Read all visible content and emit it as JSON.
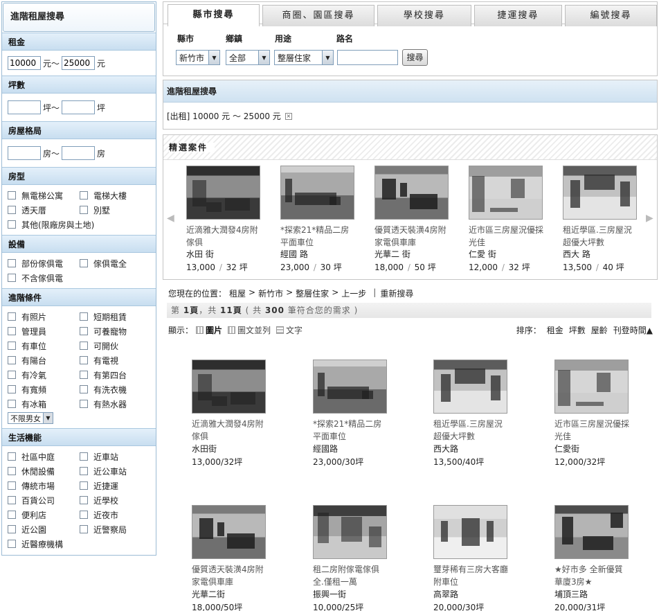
{
  "sidebar": {
    "title": "進階租屋搜尋",
    "rent": {
      "label": "租金",
      "min": "10000",
      "sep": "元～",
      "max": "25000",
      "unit": "元"
    },
    "area": {
      "label": "坪數",
      "sep": "坪～",
      "unit": "坪"
    },
    "layout": {
      "label": "房屋格局",
      "sep": "房～",
      "unit": "房"
    },
    "type": {
      "label": "房型",
      "items": [
        "無電梯公寓",
        "電梯大樓",
        "透天厝",
        "別墅",
        "其他(限廠房與土地)"
      ]
    },
    "furniture": {
      "label": "設備",
      "items": [
        "部份傢俱電",
        "傢俱電全",
        "不含傢俱電"
      ]
    },
    "advanced": {
      "label": "進階條件",
      "items": [
        "有照片",
        "短期租賃",
        "管理員",
        "可養寵物",
        "有車位",
        "可開伙",
        "有陽台",
        "有電視",
        "有冷氣",
        "有第四台",
        "有寬頻",
        "有洗衣機",
        "有冰箱",
        "有熱水器"
      ],
      "gender": "不限男女"
    },
    "life": {
      "label": "生活機能",
      "items": [
        "社區中庭",
        "近車站",
        "休閒設備",
        "近公車站",
        "傳統市場",
        "近捷運",
        "百貨公司",
        "近學校",
        "便利店",
        "近夜市",
        "近公園",
        "近警察局",
        "近醫療機構"
      ]
    }
  },
  "search": {
    "tabs": [
      "縣市搜尋",
      "商圈、園區搜尋",
      "學校搜尋",
      "捷運搜尋",
      "編號搜尋"
    ],
    "labels": {
      "county": "縣市",
      "town": "鄉鎮",
      "usage": "用途",
      "road": "路名"
    },
    "county_value": "新竹市",
    "town_value": "全部",
    "usage_value": "整層住家",
    "button": "搜尋"
  },
  "adv_box": {
    "title": "進階租屋搜尋",
    "condition": "[出租] 10000 元 ～ 25000 元",
    "remove": "×"
  },
  "featured": {
    "title": "精選案件",
    "items": [
      {
        "title": "近滴雅大潤發4房附傢俱",
        "street": "水田 街",
        "price": "13,000",
        "area": "32 坪"
      },
      {
        "title": "*探索21*精品二房平面車位",
        "street": "經國 路",
        "price": "23,000",
        "area": "30 坪"
      },
      {
        "title": "優質透天裝潢4房附家電俱車庫",
        "street": "光華二 街",
        "price": "18,000",
        "area": "50 坪"
      },
      {
        "title": "近市區三房屋況優採光佳",
        "street": "仁愛 街",
        "price": "12,000",
        "area": "32 坪"
      },
      {
        "title": "租近學區.三房屋況超優大坪數",
        "street": "西大 路",
        "price": "13,500",
        "area": "40 坪"
      }
    ]
  },
  "breadcrumb": {
    "prefix": "您現在的位置：",
    "items": [
      "租屋",
      "新竹市",
      "整層住家",
      "上一步"
    ],
    "reset": "重新搜尋"
  },
  "paging": {
    "pre": "第",
    "page": "1頁",
    "mid": "，共",
    "total_pages": "11頁",
    "count_pre": "( 共",
    "count": "300",
    "count_post": "筆符合您的需求 )"
  },
  "view": {
    "label": "顯示：",
    "options": [
      "圖片",
      "圖文並列",
      "文字"
    ]
  },
  "sort": {
    "label": "排序：",
    "options": [
      "租金",
      "坪數",
      "屋齡",
      "刊登時間▲"
    ]
  },
  "listings": [
    {
      "title": "近滴雅大潤發4房附傢俱",
      "street": "水田街",
      "price": "13,000/32坪"
    },
    {
      "title": "*探索21*精品二房平面車位",
      "street": "經國路",
      "price": "23,000/30坪"
    },
    {
      "title": "租近學區.三房屋況超優大坪數",
      "street": "西大路",
      "price": "13,500/40坪"
    },
    {
      "title": "近市區三房屋況優採光佳",
      "street": "仁愛街",
      "price": "12,000/32坪"
    },
    {
      "title": "優質透天裝潢4房附家電俱車庫",
      "street": "光華二街",
      "price": "18,000/50坪"
    },
    {
      "title": "租二房附傢電傢俱全.僅租一萬",
      "street": "振興一街",
      "price": "10,000/25坪"
    },
    {
      "title": "璽芽稀有三房大客廳附車位",
      "street": "高翠路",
      "price": "20,000/30坪"
    },
    {
      "title": "★好市多 全新優質華廈3房★",
      "street": "埔頂三路",
      "price": "20,000/31坪"
    }
  ]
}
